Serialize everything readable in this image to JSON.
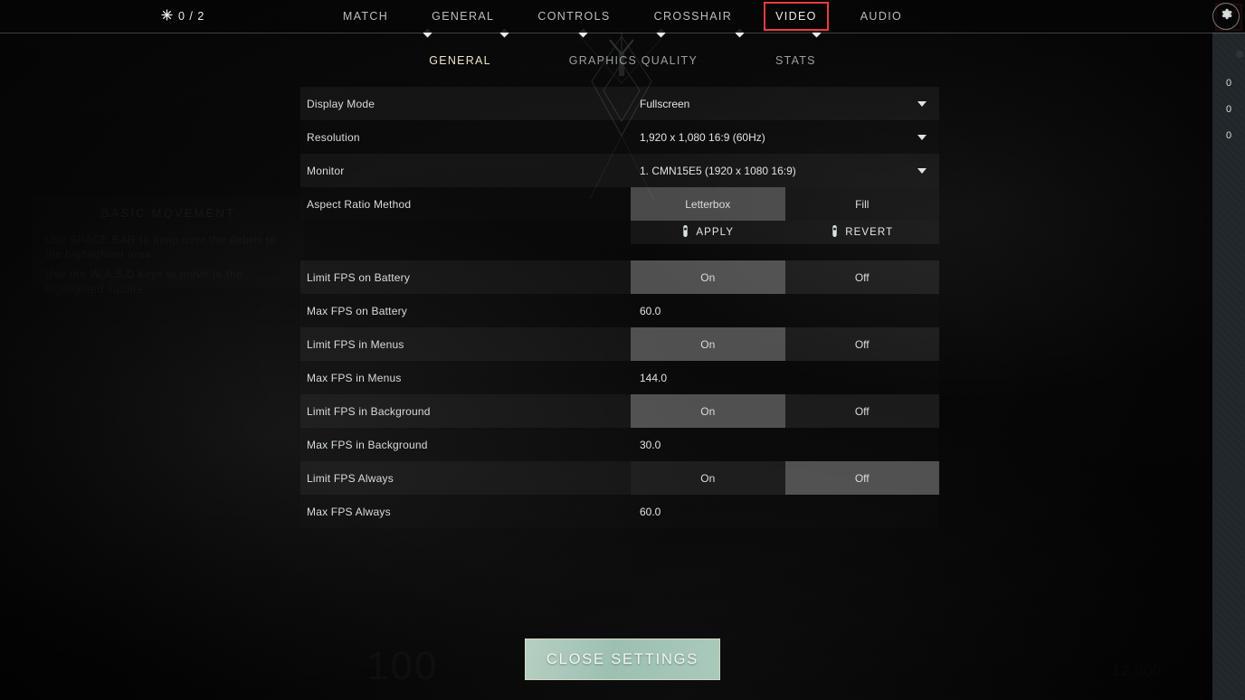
{
  "header": {
    "spike_icon": "spike-burst-icon",
    "spike_count": "0 / 2",
    "gear_icon": "gear-icon",
    "main_tabs": [
      {
        "label": "MATCH",
        "highlighted": false
      },
      {
        "label": "GENERAL",
        "highlighted": false
      },
      {
        "label": "CONTROLS",
        "highlighted": false
      },
      {
        "label": "CROSSHAIR",
        "highlighted": false
      },
      {
        "label": "VIDEO",
        "highlighted": true
      },
      {
        "label": "AUDIO",
        "highlighted": false
      }
    ],
    "highlight_color": "#ef3b3b"
  },
  "sub_tabs": [
    {
      "label": "GENERAL",
      "active": true
    },
    {
      "label": "GRAPHICS QUALITY",
      "active": false
    },
    {
      "label": "STATS",
      "active": false
    }
  ],
  "settings": {
    "rows": [
      {
        "label": "Display Mode",
        "type": "dropdown",
        "value": "Fullscreen"
      },
      {
        "label": "Resolution",
        "type": "dropdown",
        "value": "1,920 x 1,080 16:9 (60Hz)"
      },
      {
        "label": "Monitor",
        "type": "dropdown",
        "value": "1. CMN15E5 (1920 x  1080 16:9)"
      },
      {
        "label": "Aspect Ratio Method",
        "type": "segmented",
        "options": [
          "Letterbox",
          "Fill"
        ],
        "selected": "Letterbox"
      },
      {
        "label": "Limit FPS on Battery",
        "type": "segmented",
        "options": [
          "On",
          "Off"
        ],
        "selected": "On"
      },
      {
        "label": "Max FPS on Battery",
        "type": "value",
        "value": "60.0"
      },
      {
        "label": "Limit FPS in Menus",
        "type": "segmented",
        "options": [
          "On",
          "Off"
        ],
        "selected": "On"
      },
      {
        "label": "Max FPS in Menus",
        "type": "value",
        "value": "144.0"
      },
      {
        "label": "Limit FPS in Background",
        "type": "segmented",
        "options": [
          "On",
          "Off"
        ],
        "selected": "On"
      },
      {
        "label": "Max FPS in Background",
        "type": "value",
        "value": "30.0"
      },
      {
        "label": "Limit FPS Always",
        "type": "segmented",
        "options": [
          "On",
          "Off"
        ],
        "selected": "Off"
      },
      {
        "label": "Max FPS Always",
        "type": "value",
        "value": "60.0"
      }
    ],
    "actions": {
      "apply_label": "APPLY",
      "revert_label": "REVERT",
      "apply_icon": "key-icon",
      "revert_icon": "key-icon"
    }
  },
  "footer": {
    "close_label": "CLOSE SETTINGS"
  },
  "right_rail": {
    "logo_icon": "valorant-logo-icon",
    "numbers": [
      "0",
      "0",
      "0"
    ]
  },
  "background": {
    "tutorial_title": "BASIC MOVEMENT",
    "tutorial_line_1": "Use SPACE BAR to jump over the debris to the highlighted area",
    "tutorial_line_2": "Use the W,A,S,D keys to move to the highlighted square",
    "health": "100",
    "credits": "12,000"
  }
}
